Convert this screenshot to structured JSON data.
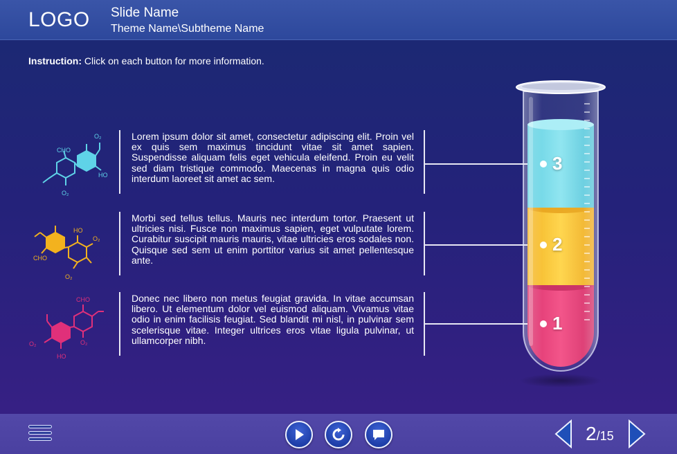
{
  "header": {
    "logo": "LOGO",
    "slide_name": "Slide Name",
    "theme_name": "Theme Name\\Subtheme Name"
  },
  "instruction": {
    "label": "Instruction:",
    "text": " Click on each button for more information."
  },
  "items": [
    {
      "text": "Lorem ipsum dolor sit amet, consectetur adipiscing elit. Proin vel ex quis sem maximus tincidunt vitae sit amet sapien. Suspendisse aliquam felis eget vehicula eleifend. Proin eu velit sed diam tristique commodo. Maecenas in magna quis odio interdum laoreet sit amet ac sem.",
      "color": "#5fd3e8",
      "mol_labels": {
        "a": "CHO",
        "b": "O₂",
        "c": "HO",
        "d": "O₂"
      },
      "number": "3"
    },
    {
      "text": "Morbi sed tellus tellus. Mauris nec interdum tortor. Praesent ut ultricies nisi. Fusce non maximus sapien, eget vulputate lorem. Curabitur suscipit mauris mauris, vitae ultricies eros sodales non. Quisque sed sem ut enim porttitor varius sit amet pellentesque ante.",
      "color": "#f3b21e",
      "mol_labels": {
        "a": "HO",
        "b": "O₂",
        "c": "CHO",
        "d": "O₂"
      },
      "number": "2"
    },
    {
      "text": "Donec nec libero non metus feugiat gravida. In vitae accumsan libero. Ut elementum dolor vel euismod aliquam. Vivamus vitae odio in enim facilisis feugiat. Sed blandit mi nisl, in pulvinar sem scelerisque vitae. Integer ultrices eros vitae ligula pulvinar, ut ullamcorper nibh.",
      "color": "#e0307a",
      "mol_labels": {
        "a": "CHO",
        "b": "O₂",
        "c": "O₂",
        "d": "HO"
      },
      "number": "1"
    }
  ],
  "tube_colors": {
    "top": "#6ad6e6",
    "middle": "#f8bf28",
    "bottom": "#e3336f"
  },
  "footer": {
    "page_current": "2",
    "page_total": "/15"
  },
  "icons": {
    "menu": "hamburger-menu-icon",
    "play": "play-icon",
    "replay": "replay-icon",
    "comment": "comment-icon",
    "prev": "chevron-left-icon",
    "next": "chevron-right-icon"
  }
}
